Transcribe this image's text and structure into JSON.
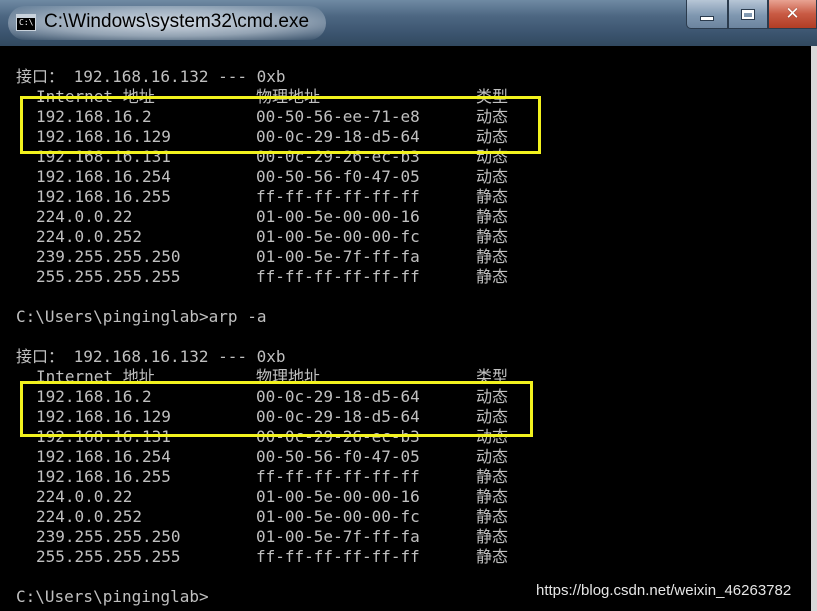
{
  "window": {
    "title": "C:\\Windows\\system32\\cmd.exe",
    "icon_text": "C:\\",
    "minimize_icon": "minimize-icon",
    "maximize_icon": "maximize-icon",
    "close_icon": "close-icon",
    "close_glyph": "✕"
  },
  "sections": [
    {
      "interface": "接口： 192.168.16.132 --- 0xb",
      "headers": {
        "ip": "Internet 地址",
        "mac": "物理地址",
        "type": "类型"
      },
      "rows": [
        {
          "ip": "192.168.16.2",
          "mac": "00-50-56-ee-71-e8",
          "type": "动态"
        },
        {
          "ip": "192.168.16.129",
          "mac": "00-0c-29-18-d5-64",
          "type": "动态"
        },
        {
          "ip": "192.168.16.131",
          "mac": "00-0c-29-26-ec-b3",
          "type": "动态"
        },
        {
          "ip": "192.168.16.254",
          "mac": "00-50-56-f0-47-05",
          "type": "动态"
        },
        {
          "ip": "192.168.16.255",
          "mac": "ff-ff-ff-ff-ff-ff",
          "type": "静态"
        },
        {
          "ip": "224.0.0.22",
          "mac": "01-00-5e-00-00-16",
          "type": "静态"
        },
        {
          "ip": "224.0.0.252",
          "mac": "01-00-5e-00-00-fc",
          "type": "静态"
        },
        {
          "ip": "239.255.255.250",
          "mac": "01-00-5e-7f-ff-fa",
          "type": "静态"
        },
        {
          "ip": "255.255.255.255",
          "mac": "ff-ff-ff-ff-ff-ff",
          "type": "静态"
        }
      ]
    },
    {
      "interface": "接口： 192.168.16.132 --- 0xb",
      "headers": {
        "ip": "Internet 地址",
        "mac": "物理地址",
        "type": "类型"
      },
      "rows": [
        {
          "ip": "192.168.16.2",
          "mac": "00-0c-29-18-d5-64",
          "type": "动态"
        },
        {
          "ip": "192.168.16.129",
          "mac": "00-0c-29-18-d5-64",
          "type": "动态"
        },
        {
          "ip": "192.168.16.131",
          "mac": "00-0c-29-26-ec-b3",
          "type": "动态"
        },
        {
          "ip": "192.168.16.254",
          "mac": "00-50-56-f0-47-05",
          "type": "动态"
        },
        {
          "ip": "192.168.16.255",
          "mac": "ff-ff-ff-ff-ff-ff",
          "type": "静态"
        },
        {
          "ip": "224.0.0.22",
          "mac": "01-00-5e-00-00-16",
          "type": "静态"
        },
        {
          "ip": "224.0.0.252",
          "mac": "01-00-5e-00-00-fc",
          "type": "静态"
        },
        {
          "ip": "239.255.255.250",
          "mac": "01-00-5e-7f-ff-fa",
          "type": "静态"
        },
        {
          "ip": "255.255.255.255",
          "mac": "ff-ff-ff-ff-ff-ff",
          "type": "静态"
        }
      ]
    }
  ],
  "commands": {
    "arp_command": "C:\\Users\\pinginglab>arp -a",
    "final_prompt": "C:\\Users\\pinginglab>"
  },
  "highlight_color": "#f2f21e",
  "watermark": "https://blog.csdn.net/weixin_46263782"
}
